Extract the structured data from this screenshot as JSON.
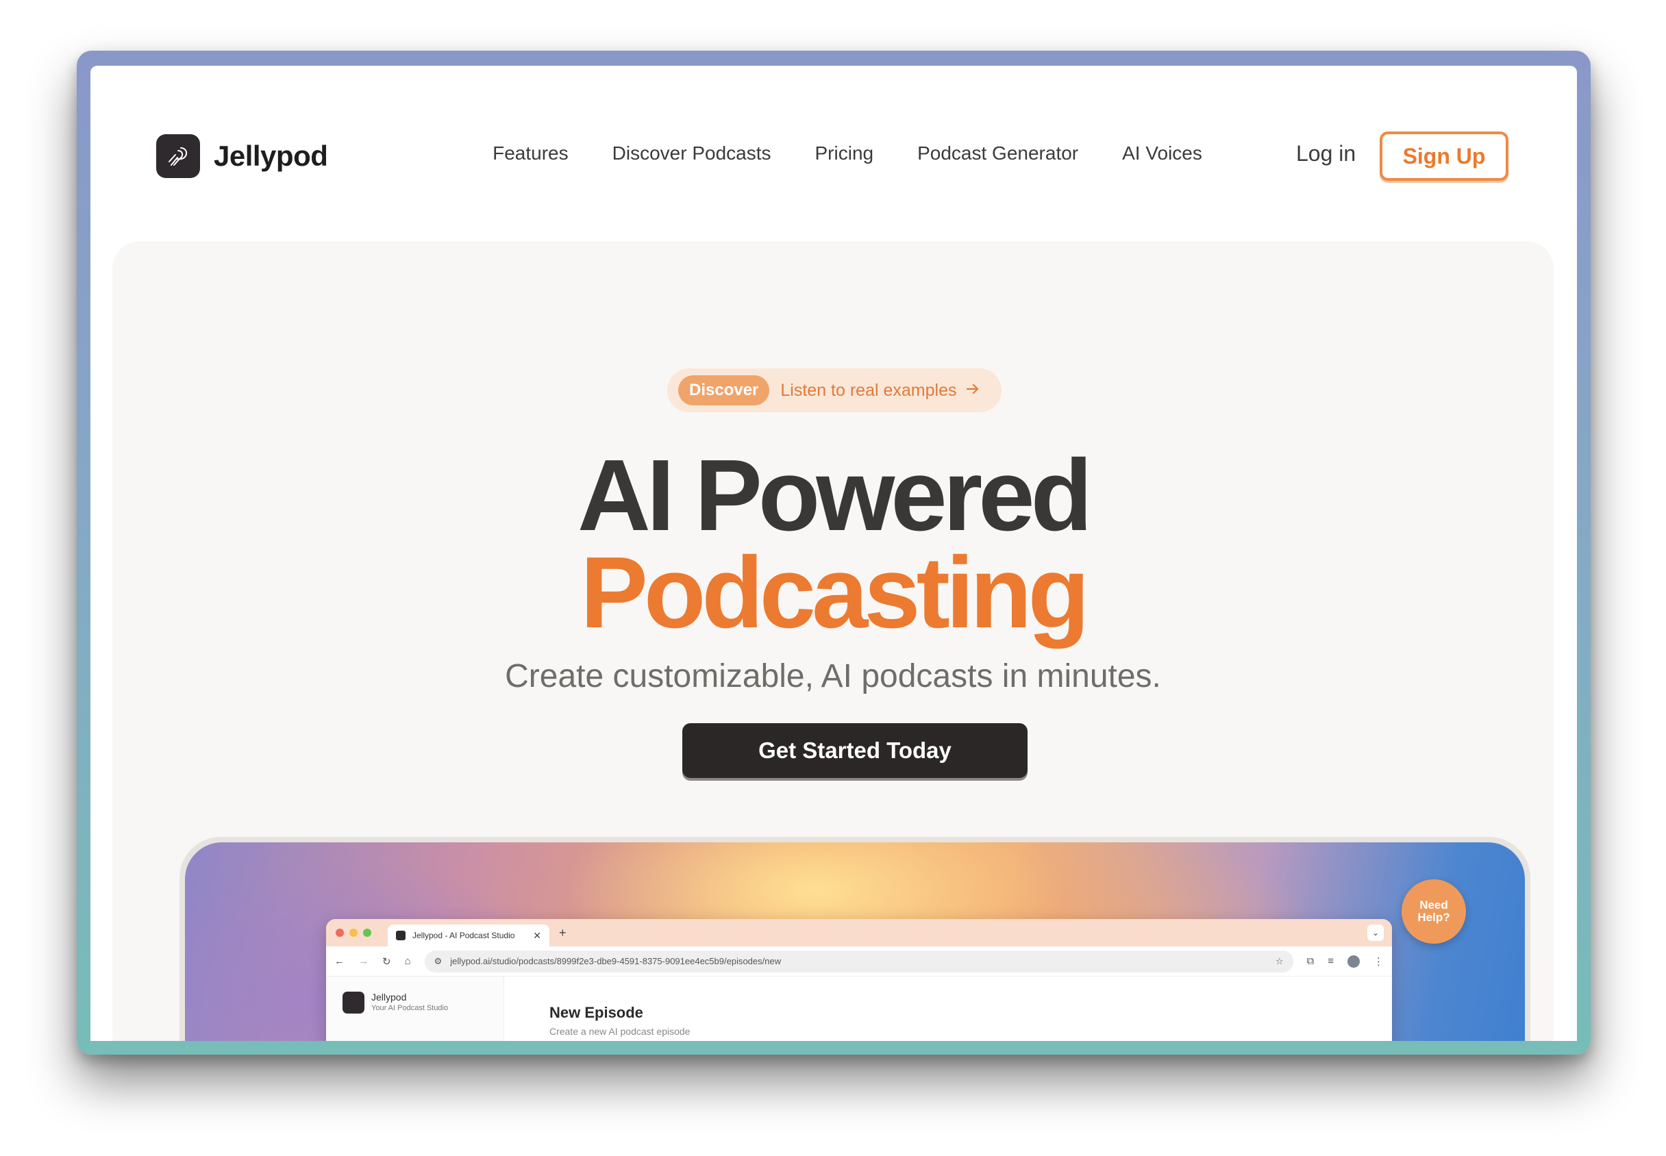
{
  "brand": {
    "name": "Jellypod"
  },
  "nav": {
    "items": [
      {
        "label": "Features"
      },
      {
        "label": "Discover Podcasts"
      },
      {
        "label": "Pricing"
      },
      {
        "label": "Podcast Generator"
      },
      {
        "label": "AI Voices"
      }
    ],
    "login_label": "Log in",
    "signup_label": "Sign Up"
  },
  "hero": {
    "pill_badge": "Discover",
    "pill_text": "Listen to real examples",
    "headline_line1": "AI Powered",
    "headline_line2": "Podcasting",
    "subhead": "Create customizable, AI podcasts in minutes.",
    "cta_label": "Get Started Today"
  },
  "preview": {
    "tab_title": "Jellypod - AI Podcast Studio",
    "url": "jellypod.ai/studio/podcasts/8999f2e3-dbe9-4591-8375-9091ee4ec5b9/episodes/new",
    "sidebar_title": "Jellypod",
    "sidebar_subtitle": "Your AI Podcast Studio",
    "main_title": "New Episode",
    "main_subtitle": "Create a new AI podcast episode"
  },
  "help": {
    "line1": "Need",
    "line2": "Help?"
  },
  "colors": {
    "accent": "#ec7a30",
    "dark": "#2b2727",
    "hero_bg": "#f8f7f5"
  }
}
